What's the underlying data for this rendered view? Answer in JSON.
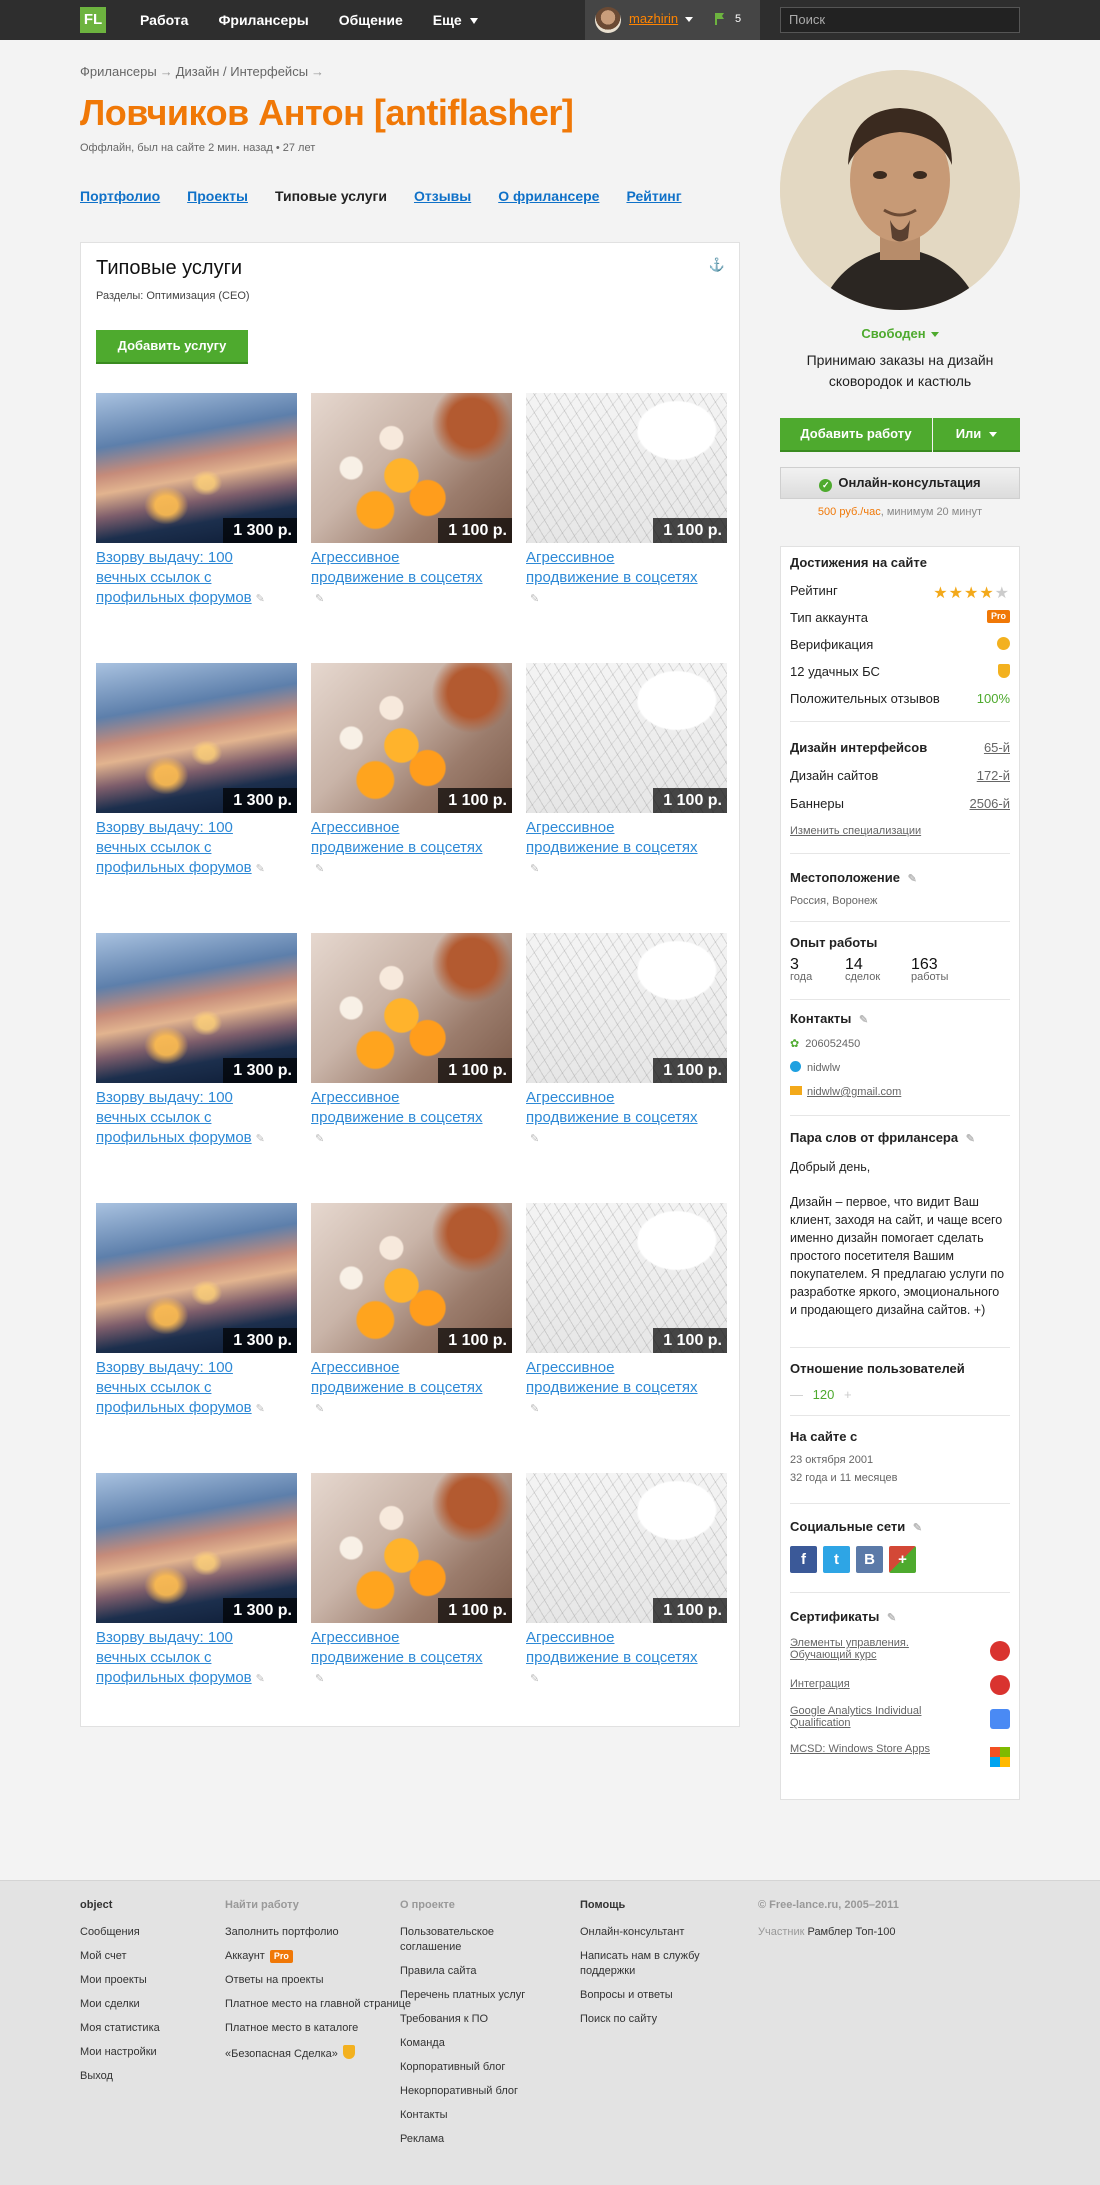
{
  "topbar": {
    "logo": "FL",
    "nav": [
      "Работа",
      "Фрилансеры",
      "Общение",
      "Еще"
    ],
    "username": "mazhirin",
    "count": "5",
    "search_placeholder": "Поиск"
  },
  "breadcrumb": [
    "Фрилансеры",
    "Дизайн / Интерфейсы"
  ],
  "profile": {
    "name": "Ловчиков Антон [antiflasher]",
    "status": "Оффлайн, был на сайте 2 мин. назад • 27 лет"
  },
  "tabs": [
    "Портфолио",
    "Проекты",
    "Типовые услуги",
    "Отзывы",
    "О фрилансере",
    "Рейтинг"
  ],
  "services": {
    "title": "Типовые услуги",
    "sections": "Разделы: Оптимизация (СЕО)",
    "add_button": "Добавить услугу",
    "items": [
      {
        "title": "Взорву выдачу: 100 вечных ссылок с профильных  форумов",
        "price": "1 300 р.",
        "img": "city"
      },
      {
        "title": "Агрессивное продвижение в соцсетях",
        "price": "1 100 р.",
        "img": "flower"
      },
      {
        "title": "Агрессивное продвижение в соцсетях",
        "price": "1 100 р.",
        "img": "snow"
      },
      {
        "title": "Взорву выдачу: 100 вечных ссылок с профильных  форумов",
        "price": "1 300 р.",
        "img": "city"
      },
      {
        "title": "Агрессивное продвижение в соцсетях",
        "price": "1 100 р.",
        "img": "flower"
      },
      {
        "title": "Агрессивное продвижение в соцсетях",
        "price": "1 100 р.",
        "img": "snow"
      },
      {
        "title": "Взорву выдачу: 100 вечных ссылок с профильных  форумов",
        "price": "1 300 р.",
        "img": "city"
      },
      {
        "title": "Агрессивное продвижение в соцсетях",
        "price": "1 100 р.",
        "img": "flower"
      },
      {
        "title": "Агрессивное продвижение в соцсетях",
        "price": "1 100 р.",
        "img": "snow"
      },
      {
        "title": "Взорву выдачу: 100 вечных ссылок с профильных  форумов",
        "price": "1 300 р.",
        "img": "city"
      },
      {
        "title": "Агрессивное продвижение в соцсетях",
        "price": "1 100 р.",
        "img": "flower"
      },
      {
        "title": "Агрессивное продвижение в соцсетях",
        "price": "1 100 р.",
        "img": "snow"
      },
      {
        "title": "Взорву выдачу: 100 вечных ссылок с профильных  форумов",
        "price": "1 300 р.",
        "img": "city"
      },
      {
        "title": "Агрессивное продвижение в соцсетях",
        "price": "1 100 р.",
        "img": "flower"
      },
      {
        "title": "Агрессивное продвижение в соцсетях",
        "price": "1 100 р.",
        "img": "snow"
      }
    ]
  },
  "sidebar": {
    "availability": "Свободен",
    "tagline": "Принимаю заказы на дизайн сковородок и кастюль",
    "add_work": "Добавить работу",
    "or": "Или",
    "consult": "Онлайн-консультация",
    "rate_price": "500 руб./час",
    "rate_min": ", минимум 20 минут",
    "achievements": {
      "title": "Достижения на сайте",
      "rating_label": "Рейтинг",
      "rating_stars": 4,
      "account_label": "Тип аккаунта",
      "account_badge": "Pro",
      "verify_label": "Верификация",
      "bs_label": "12 удачных БС",
      "positive_label": "Положительных отзывов",
      "positive_value": "100%"
    },
    "specs": {
      "rows": [
        {
          "label": "Дизайн интерфейсов",
          "value": "65-й"
        },
        {
          "label": "Дизайн сайтов",
          "value": "172-й"
        },
        {
          "label": "Баннеры",
          "value": "2506-й"
        }
      ],
      "change": "Изменить специализации"
    },
    "location": {
      "title": "Местоположение",
      "value": "Россия, Воронеж"
    },
    "experience": {
      "title": "Опыт работы",
      "items": [
        {
          "num": "3",
          "label": "года"
        },
        {
          "num": "14",
          "label": "сделок"
        },
        {
          "num": "163",
          "label": "работы"
        }
      ]
    },
    "contacts": {
      "title": "Контакты",
      "icq": "206052450",
      "skype": "nidwlw",
      "email": "nidwlw@gmail.com"
    },
    "about": {
      "title": "Пара слов от фрилансера",
      "greeting": "Добрый день,",
      "text": "Дизайн – первое, что видит Ваш клиент, заходя на сайт, и чаще всего именно дизайн помогает сделать простого посетителя Вашим покупателем. Я предлагаю услуги по разработке яркого, эмоционального и продающего дизайна сайтов. +)"
    },
    "attitude": {
      "title": "Отношение пользователей",
      "minus": "—",
      "value": "120",
      "plus": "+"
    },
    "onsite": {
      "title": "На сайте с",
      "date": "23 октября 2001",
      "duration": "32 года и 11 месяцев"
    },
    "social": {
      "title": "Социальные сети",
      "items": [
        "f",
        "t",
        "B",
        "+"
      ]
    },
    "certificates": {
      "title": "Сертификаты",
      "items": [
        {
          "text": "Элементы управления. Обучающий курс",
          "icon": "opera-icon"
        },
        {
          "text": "Интеграция",
          "icon": "opera-icon"
        },
        {
          "text": "Google Analytics Individual Qualification",
          "icon": "google-icon"
        },
        {
          "text": "MCSD: Windows Store Apps",
          "icon": "windows-icon"
        }
      ]
    }
  },
  "footer": {
    "col1": {
      "title": "object",
      "items": [
        "Сообщения",
        "Мой счет",
        "Мои проекты",
        "Мои сделки",
        "Моя статистика",
        "Мои настройки",
        "Выход"
      ]
    },
    "col2": {
      "title": "Найти работу",
      "items": [
        "Заполнить портфолио",
        "Аккаунт",
        "Ответы на проекты",
        "Платное место на главной странице",
        "Платное место в каталоге",
        "«Безопасная Сделка»"
      ],
      "pro": "Pro"
    },
    "col3": {
      "title": "О проекте",
      "items": [
        "Пользовательское соглашение",
        "Правила сайта",
        "Перечень платных услуг",
        "Требования к ПО",
        "Команда",
        "Корпоративный блог",
        "Некорпоративный блог",
        "Контакты",
        "Реклама"
      ]
    },
    "col4": {
      "title": "Помощь",
      "items": [
        "Онлайн-консультант",
        "Написать нам в службу поддержки",
        "Вопросы и ответы",
        "Поиск по сайту"
      ]
    },
    "copyright": "© Free-lance.ru, 2005–2011",
    "participant_label": "Участник",
    "participant": "Рамблер Топ-100"
  },
  "colors": {
    "accent": "#f07807",
    "green": "#4eaa2e",
    "link": "#0f71c8"
  }
}
